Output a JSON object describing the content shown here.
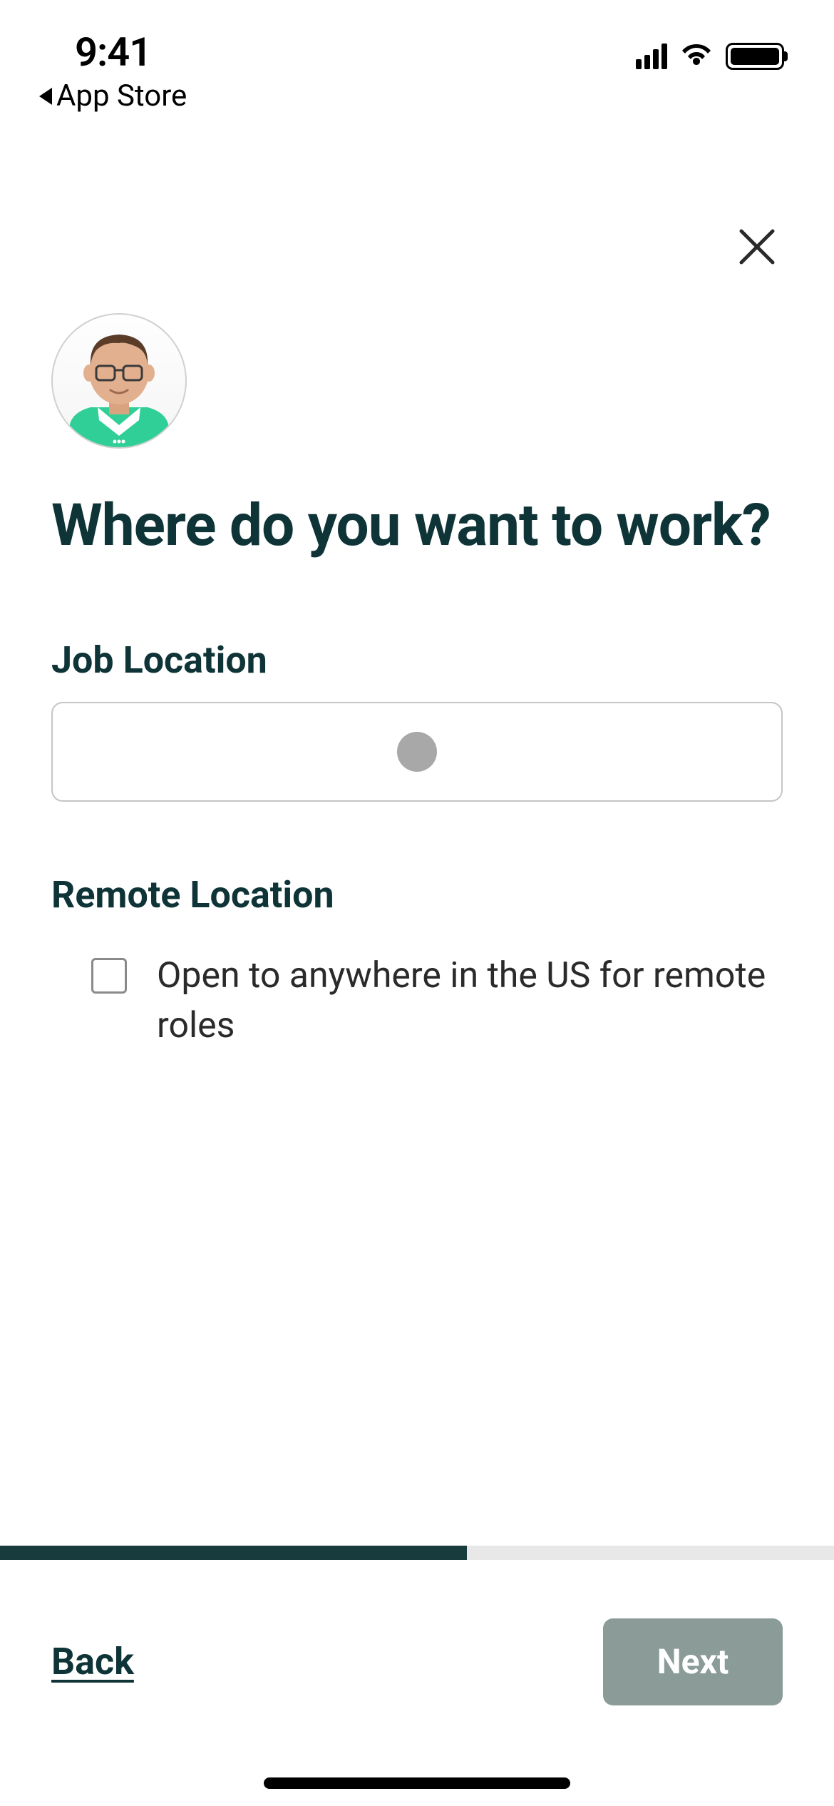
{
  "status_bar": {
    "time": "9:41",
    "back_app_label": "App Store"
  },
  "page": {
    "title": "Where do you want to work?"
  },
  "form": {
    "job_location_label": "Job Location",
    "job_location_value": "",
    "remote_label": "Remote Location",
    "remote_checkbox_label": "Open to anywhere in the US for remote roles",
    "remote_checked": false,
    "loading": true
  },
  "progress": {
    "percent": 56
  },
  "footer": {
    "back_label": "Back",
    "next_label": "Next",
    "next_disabled": true
  },
  "colors": {
    "brand_dark": "#0f3437",
    "next_disabled_bg": "#8a9b98"
  }
}
